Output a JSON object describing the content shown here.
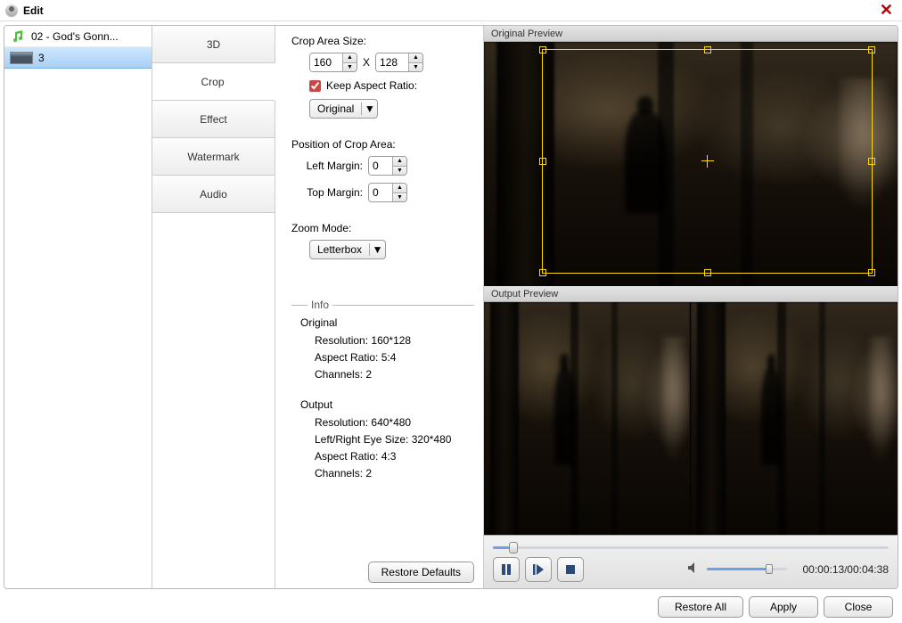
{
  "window": {
    "title": "Edit"
  },
  "filelist": {
    "items": [
      {
        "label": "02 - God's Gonn...",
        "icon": "music"
      },
      {
        "label": "3",
        "icon": "thumb",
        "selected": true
      }
    ]
  },
  "tabs": {
    "items": [
      {
        "label": "3D"
      },
      {
        "label": "Crop",
        "selected": true
      },
      {
        "label": "Effect"
      },
      {
        "label": "Watermark"
      },
      {
        "label": "Audio"
      }
    ]
  },
  "crop": {
    "area_label": "Crop Area Size:",
    "width": "160",
    "height": "128",
    "x_sep": "X",
    "keep_ratio_checked": true,
    "keep_ratio_label": "Keep Aspect Ratio:",
    "ratio_value": "Original",
    "pos_label": "Position of Crop Area:",
    "left_label": "Left Margin:",
    "left_value": "0",
    "top_label": "Top Margin:",
    "top_value": "0",
    "zoom_label": "Zoom Mode:",
    "zoom_value": "Letterbox"
  },
  "info": {
    "header": "Info",
    "original_title": "Original",
    "original": {
      "resolution_label": "Resolution:",
      "resolution": "160*128",
      "aspect_label": "Aspect Ratio:",
      "aspect": "5:4",
      "channels_label": "Channels:",
      "channels": "2"
    },
    "output_title": "Output",
    "output": {
      "resolution_label": "Resolution:",
      "resolution": "640*480",
      "eyesize_label": "Left/Right Eye Size:",
      "eyesize": "320*480",
      "aspect_label": "Aspect Ratio:",
      "aspect": "4:3",
      "channels_label": "Channels:",
      "channels": "2"
    }
  },
  "buttons": {
    "restore_defaults": "Restore Defaults",
    "restore_all": "Restore All",
    "apply": "Apply",
    "close": "Close"
  },
  "preview": {
    "original_label": "Original Preview",
    "output_label": "Output Preview"
  },
  "player": {
    "time_current": "00:00:13",
    "time_total": "00:04:38"
  }
}
